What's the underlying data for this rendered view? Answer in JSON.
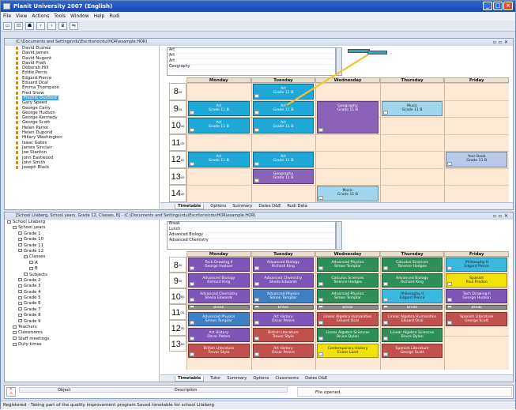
{
  "window": {
    "title": "Planit University 2007 (English)"
  },
  "menu": [
    "File",
    "View",
    "Actions",
    "Tools",
    "Window",
    "Help",
    "Rudi"
  ],
  "toolbar": [
    "▭",
    "⊡",
    "☗",
    "‹",
    "›",
    "♛",
    "⇋"
  ],
  "top": {
    "title": "(C:\\Documents and Settings\\rdu\\Escritorio\\rdu\\HOR\\example.HOR)",
    "people": [
      "David Dumez",
      "David James",
      "David Nugent",
      "David Pratt",
      "Deborah Hill",
      "Eddie Perris",
      "Edgard Pierce",
      "Eduard Ocal",
      "Emma Thompson",
      "Fred Snow",
      "Fredrik Dunford",
      "Gary Speed",
      "George Carry",
      "George Hudson",
      "George Kennedy",
      "George Scott",
      "Helen Parrot",
      "Helen Dupond",
      "Hillary Washington",
      "Isaac Gates",
      "James Sinclair",
      "Joe Stanton",
      "John Eastwood",
      "John Smith",
      "Joseph Black"
    ],
    "selected_index": 10,
    "lesson_list": [
      "Art",
      "Art",
      "Art",
      "Geography"
    ],
    "days": [
      "Monday",
      "Tuesday",
      "Wednesday",
      "Thursday",
      "Friday"
    ],
    "hours": [
      "8",
      "9",
      "10",
      "11",
      "12",
      "13",
      "14"
    ],
    "lessons": [
      {
        "day": 1,
        "start": 0,
        "len": 1,
        "color": "#1ea8d8",
        "text": "Art\nGrade 11 B"
      },
      {
        "day": 0,
        "start": 1,
        "len": 1,
        "color": "#1ea8d8",
        "text": "Art\nGrade 11 B"
      },
      {
        "day": 1,
        "start": 1,
        "len": 1,
        "color": "#1ea8d8",
        "text": "Art\nGrade 11 B"
      },
      {
        "day": 0,
        "start": 2,
        "len": 1,
        "color": "#1ea8d8",
        "text": "Art\nGrade 11 B"
      },
      {
        "day": 1,
        "start": 2,
        "len": 1,
        "color": "#1ea8d8",
        "text": "Art\nGrade 11 B"
      },
      {
        "day": 2,
        "start": 1,
        "len": 2,
        "color": "#8a62b8",
        "text": "Geography\nGrade 11 B"
      },
      {
        "day": 3,
        "start": 1,
        "len": 1,
        "color": "#9fd6ee",
        "text": "Music\nGrade 11 B"
      },
      {
        "day": 0,
        "start": 4,
        "len": 1,
        "color": "#1ea8d8",
        "text": "Art\nGrade 11 B"
      },
      {
        "day": 1,
        "start": 4,
        "len": 1,
        "color": "#1ea8d8",
        "text": "Art\nGrade 11 B"
      },
      {
        "day": 4,
        "start": 4,
        "len": 1,
        "color": "#b9c9ea",
        "text": "Year Book\nGrade 11 B"
      },
      {
        "day": 1,
        "start": 5,
        "len": 1,
        "color": "#8a62b8",
        "text": "Geography\nGrade 11 B"
      },
      {
        "day": 2,
        "start": 6,
        "len": 1,
        "color": "#9fd6ee",
        "text": "Music\nGrade 11 B"
      }
    ],
    "tabs": [
      "Timetable",
      "Options",
      "Summary",
      "Dates D&E",
      "Rudi Data"
    ]
  },
  "bottom": {
    "title": "[School Lilaberg, School years, Grade 12, Classes, B] - (C:\\Documents and Settings\\rdu\\Escritorio\\rdu\\HOR\\example.HOR)",
    "tree": [
      {
        "d": 0,
        "t": "School Lilaberg"
      },
      {
        "d": 1,
        "t": "School years"
      },
      {
        "d": 2,
        "t": "Grade 1"
      },
      {
        "d": 2,
        "t": "Grade 10"
      },
      {
        "d": 2,
        "t": "Grade 11"
      },
      {
        "d": 2,
        "t": "Grade 12"
      },
      {
        "d": 3,
        "t": "Classes"
      },
      {
        "d": 4,
        "t": "A"
      },
      {
        "d": 4,
        "t": "B"
      },
      {
        "d": 3,
        "t": "Subjects"
      },
      {
        "d": 2,
        "t": "Grade 2"
      },
      {
        "d": 2,
        "t": "Grade 3"
      },
      {
        "d": 2,
        "t": "Grade 4"
      },
      {
        "d": 2,
        "t": "Grade 5"
      },
      {
        "d": 2,
        "t": "Grade 6"
      },
      {
        "d": 2,
        "t": "Grade 7"
      },
      {
        "d": 2,
        "t": "Grade 8"
      },
      {
        "d": 2,
        "t": "Grade 9"
      },
      {
        "d": 1,
        "t": "Teachers"
      },
      {
        "d": 1,
        "t": "Classrooms"
      },
      {
        "d": 1,
        "t": "Staff meetings"
      },
      {
        "d": 1,
        "t": "Duty times"
      }
    ],
    "lesson_list": [
      "Break",
      "Lunch",
      "Advanced Biology",
      "Advanced Chemistry"
    ],
    "days": [
      "Monday",
      "Tuesday",
      "Wednesday",
      "Thursday",
      "Friday"
    ],
    "hours": [
      "8",
      "9",
      "10",
      "11",
      "12",
      "13"
    ],
    "lessons": [
      {
        "day": 0,
        "start": 0,
        "color": "#7e56b8",
        "text": "Tech Drawing II\nGeorge Hudson"
      },
      {
        "day": 1,
        "start": 0,
        "color": "#7e56b8",
        "text": "Advanced Biology\nRichard King"
      },
      {
        "day": 2,
        "start": 0,
        "color": "#2f8f5a",
        "text": "Advanced Physics\nSimon Templar"
      },
      {
        "day": 3,
        "start": 0,
        "color": "#2f8f5a",
        "text": "Calculus Sciences\nTerence Hodges"
      },
      {
        "day": 4,
        "start": 0,
        "color": "#3ab8e0",
        "text": "Philosophy II\nEdgard Pierce"
      },
      {
        "day": 0,
        "start": 1,
        "color": "#7e56b8",
        "text": "Advanced Biology\nRichard King"
      },
      {
        "day": 1,
        "start": 1,
        "color": "#7e56b8",
        "text": "Advanced Chemistry\nSheila Edwards"
      },
      {
        "day": 2,
        "start": 1,
        "color": "#2f8f5a",
        "text": "Calculus Sciences\nTerence Hodges"
      },
      {
        "day": 3,
        "start": 1,
        "color": "#2f8f5a",
        "text": "Advanced Biology\nRichard King"
      },
      {
        "day": 4,
        "start": 1,
        "color": "#f2e20a",
        "text": "Spanish\nPaul Pradon"
      },
      {
        "day": 0,
        "start": 2,
        "color": "#7e56b8",
        "text": "Advanced Chemistry\nSheila Edwards"
      },
      {
        "day": 1,
        "start": 2,
        "color": "#3f7fc4",
        "text": "Advanced Physics\nSimon Templar"
      },
      {
        "day": 2,
        "start": 2,
        "color": "#2f8f5a",
        "text": "Advanced Physics\nSimon Templar"
      },
      {
        "day": 3,
        "start": 2,
        "color": "#3ab8e0",
        "text": "Philosophy II\nEdgard Pierce"
      },
      {
        "day": 4,
        "start": 2,
        "color": "#7e56b8",
        "text": "Tech Drawing II\nGeorge Hudson"
      },
      {
        "day": 0,
        "start": 3,
        "color": "#8a8a8a",
        "text": "Break",
        "brk": true
      },
      {
        "day": 1,
        "start": 3,
        "color": "#8a8a8a",
        "text": "Break",
        "brk": true
      },
      {
        "day": 2,
        "start": 3,
        "color": "#8a8a8a",
        "text": "Break",
        "brk": true
      },
      {
        "day": 3,
        "start": 3,
        "color": "#8a8a8a",
        "text": "Break",
        "brk": true
      },
      {
        "day": 4,
        "start": 3,
        "color": "#8a8a8a",
        "text": "Break",
        "brk": true
      },
      {
        "day": 0,
        "start": 3.45,
        "color": "#3f7fc4",
        "text": "Advanced Physics\nSimon Templar"
      },
      {
        "day": 1,
        "start": 3.45,
        "color": "#7e56b8",
        "text": "Art History\nOscar Peters"
      },
      {
        "day": 2,
        "start": 3.45,
        "color": "#c0514d",
        "text": "Linear Algebra Humanities\nEduard Ocal"
      },
      {
        "day": 3,
        "start": 3.45,
        "color": "#c0514d",
        "text": "Linear Algebra Humanities\nEduard Ocal"
      },
      {
        "day": 4,
        "start": 3.45,
        "color": "#c0514d",
        "text": "Spanish Literature\nGeorge Scott"
      },
      {
        "day": 0,
        "start": 4.45,
        "color": "#7e56b8",
        "text": "Art History\nOscar Peters"
      },
      {
        "day": 1,
        "start": 4.45,
        "color": "#c0514d",
        "text": "British Literature\nTrevor Style"
      },
      {
        "day": 2,
        "start": 4.45,
        "color": "#2f8f5a",
        "text": "Linear Algebra Sciences\nBruce Dylan"
      },
      {
        "day": 3,
        "start": 4.45,
        "color": "#2f8f5a",
        "text": "Linear Algebra Sciences\nBruce Dylan"
      },
      {
        "day": 0,
        "start": 5.45,
        "color": "#c0514d",
        "text": "British Literature\nTrevor Style"
      },
      {
        "day": 1,
        "start": 5.45,
        "color": "#c0514d",
        "text": "Art History\nOscar Peters"
      },
      {
        "day": 2,
        "start": 5.45,
        "color": "#f2e20a",
        "text": "Contemporary History\nEvans Lund"
      },
      {
        "day": 3,
        "start": 5.45,
        "color": "#c0514d",
        "text": "Spanish Literature\nGeorge Scott"
      }
    ],
    "tabs": [
      "Timetable",
      "Tutor",
      "Summary",
      "Options",
      "Classrooms",
      "Dates D&E"
    ]
  },
  "messages": {
    "headers": [
      "Object",
      "Description"
    ],
    "info": "File opened."
  },
  "status": "Registered - Taking part of the quality improvement program Saved timetable for school Lilaberg"
}
